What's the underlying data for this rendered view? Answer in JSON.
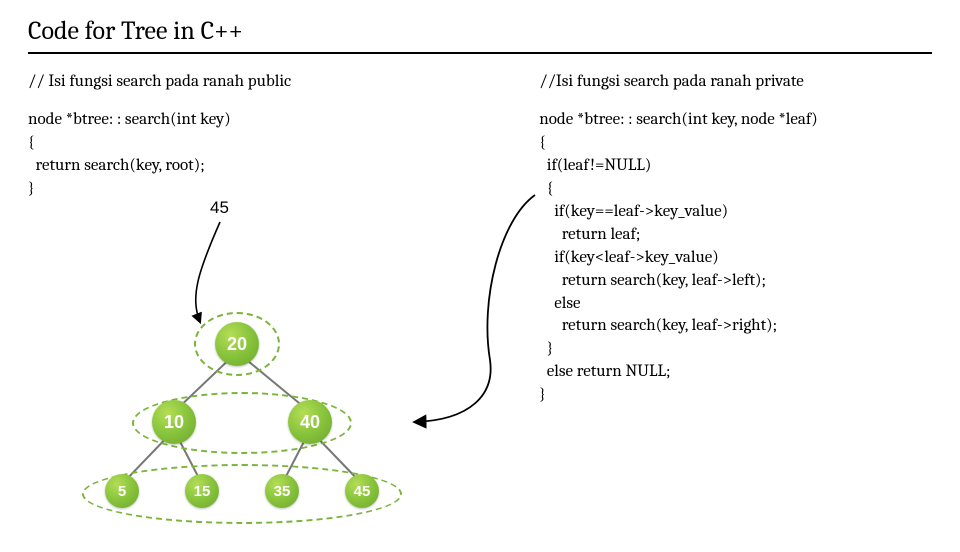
{
  "title": "Code for Tree  in C++",
  "left": {
    "comment": "// Isi fungsi search pada ranah public",
    "code": "node *btree: : search(int key)\n{\n  return search(key, root);\n}",
    "label45": "45"
  },
  "right": {
    "comment": "//Isi fungsi search pada ranah private",
    "code": "node *btree: : search(int key, node *leaf)\n{\n  if(leaf!=NULL)\n  {\n    if(key==leaf->key_value)\n      return leaf;\n    if(key<leaf->key_value)\n      return search(key, leaf->left);\n    else\n      return search(key, leaf->right);\n  }\n  else return NULL;\n}"
  },
  "tree": {
    "root": "20",
    "l": "10",
    "r": "40",
    "ll": "5",
    "lr": "15",
    "rl": "35",
    "rr": "45"
  },
  "chart_data": {
    "type": "tree-diagram",
    "title": "Binary search tree example with search(45) traversal",
    "nodes": [
      {
        "value": 20,
        "level": 0,
        "parent": null
      },
      {
        "value": 10,
        "level": 1,
        "parent": 20,
        "side": "left"
      },
      {
        "value": 40,
        "level": 1,
        "parent": 20,
        "side": "right"
      },
      {
        "value": 5,
        "level": 2,
        "parent": 10,
        "side": "left"
      },
      {
        "value": 15,
        "level": 2,
        "parent": 10,
        "side": "right"
      },
      {
        "value": 35,
        "level": 2,
        "parent": 40,
        "side": "left"
      },
      {
        "value": 45,
        "level": 2,
        "parent": 40,
        "side": "right"
      }
    ],
    "highlighted_groups": [
      [
        20
      ],
      [
        10,
        40
      ],
      [
        5,
        15,
        35,
        45
      ]
    ],
    "search_key": 45
  }
}
